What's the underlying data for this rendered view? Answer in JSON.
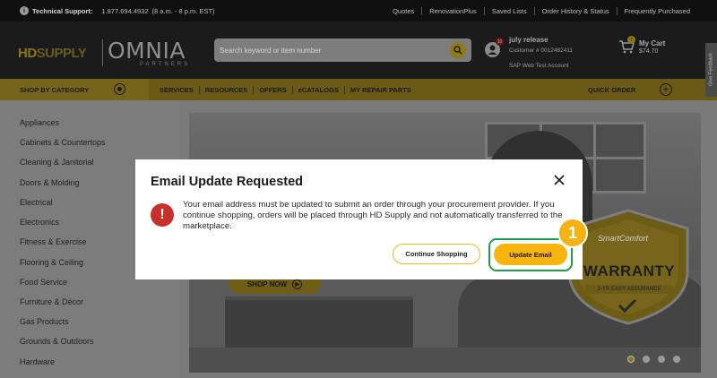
{
  "topbar": {
    "support_label": "Technical Support:",
    "support_phone": "1.877.694.4932",
    "support_hours": "(8 a.m. - 8 p.m. EST)",
    "links": [
      "Quotes",
      "RenovationPlus",
      "Saved Lists",
      "Order History & Status",
      "Frequently Purchased"
    ]
  },
  "header": {
    "logo_hd": "HD",
    "logo_supply": "SUPPLY",
    "logo_omnia": "OMNIA",
    "logo_partners": "PARTNERS",
    "search_placeholder": "Search keyword or item number",
    "account": {
      "badge": "10",
      "name": "july release",
      "customer": "Customer # 0012482411",
      "account_type": "SAP Web Test Account"
    },
    "cart": {
      "badge": "7",
      "label": "My Cart",
      "total": "$74.70"
    },
    "feedback_label": "Give Feedback"
  },
  "nav": {
    "shop_by_category": "SHOP BY CATEGORY",
    "links": [
      "SERVICES",
      "RESOURCES",
      "OFFERS",
      "eCATALOGS",
      "MY REPAIR PARTS"
    ],
    "quick_order": "QUICK ORDER"
  },
  "sidebar": {
    "categories": [
      "Appliances",
      "Cabinets & Countertops",
      "Cleaning & Janitorial",
      "Doors & Molding",
      "Electrical",
      "Electronics",
      "Fitness & Exercise",
      "Flooring & Ceiling",
      "Food Service",
      "Furniture & Décor",
      "Gas Products",
      "Grounds & Outdoors",
      "Hardware"
    ]
  },
  "hero": {
    "shop_now": "SHOP NOW",
    "brand": "SmartComfort",
    "warranty": "WARRANTY",
    "warranty_sub": "2-YR EASY ASSURANCE",
    "slides_total": 4,
    "slide_active": 1
  },
  "modal": {
    "title": "Email Update Requested",
    "message": "Your email address must be updated to submit an order through your procurement provider.  If you continue shopping, orders will be placed through HD Supply and not automatically transferred to the marketplace.",
    "continue_label": "Continue Shopping",
    "update_label": "Update Email",
    "step_number": "1"
  },
  "colors": {
    "accent_yellow": "#f7b40f",
    "alert_red": "#c8312b",
    "highlight_green": "#1aa24a"
  }
}
